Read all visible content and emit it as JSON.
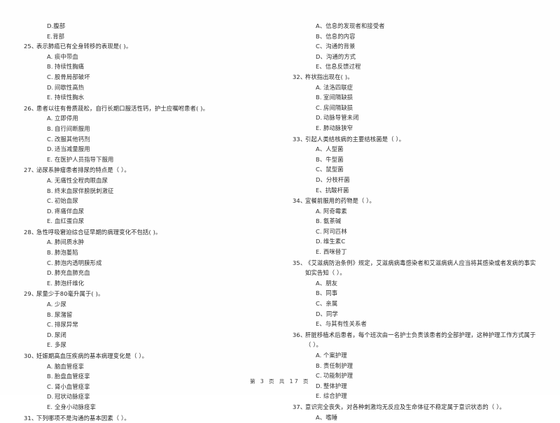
{
  "document": {
    "page_label": "第 3 页 共 17 页",
    "page_number": "3",
    "total_pages": "17"
  },
  "left_column": {
    "leading_options": [
      {
        "label": "D.",
        "text": "腹部"
      },
      {
        "label": "E.",
        "text": "背部"
      }
    ],
    "questions": [
      {
        "number": "25、",
        "stem": "表示肺癌已有全身转移的表现是(        )。",
        "options": [
          {
            "label": "A.",
            "text": "痰中带血"
          },
          {
            "label": "B.",
            "text": "持续性胸痛"
          },
          {
            "label": "C.",
            "text": "股骨局部破坏"
          },
          {
            "label": "D.",
            "text": "间歇性高热"
          },
          {
            "label": "E.",
            "text": "持续性胸水"
          }
        ]
      },
      {
        "number": "26、",
        "stem": "患者以往有骨质疏松，自行长期口服活性钙，护士应嘱咐患者(        )。",
        "options": [
          {
            "label": "A.",
            "text": "立即停用"
          },
          {
            "label": "B.",
            "text": "自行间断服用"
          },
          {
            "label": "C.",
            "text": "改服其他钙剂"
          },
          {
            "label": "D.",
            "text": "适当减量服用"
          },
          {
            "label": "E.",
            "text": "在医护人员指导下服用"
          }
        ]
      },
      {
        "number": "27、",
        "stem": "泌尿系肿瘤患者排尿的特点是（        ）。",
        "options": [
          {
            "label": "A.",
            "text": "无痛性全程肉眼血尿"
          },
          {
            "label": "B.",
            "text": "终末血尿伴膀胱刺激征"
          },
          {
            "label": "C.",
            "text": "初始血尿"
          },
          {
            "label": "D.",
            "text": "疼痛伴血尿"
          },
          {
            "label": "E.",
            "text": "血红蛋白尿"
          }
        ]
      },
      {
        "number": "28、",
        "stem": "急性呼吸窘迫综合征早期的病理变化不包括(        )。",
        "options": [
          {
            "label": "A.",
            "text": "肺间质水肿"
          },
          {
            "label": "B.",
            "text": "肺泡萎陷"
          },
          {
            "label": "C.",
            "text": "肺泡内透明膜形成"
          },
          {
            "label": "D.",
            "text": "肺充血肺充血"
          },
          {
            "label": "E.",
            "text": "肺泡纤维化"
          }
        ]
      },
      {
        "number": "29、",
        "stem": "尿量少于80毫升属于(        )。",
        "options": [
          {
            "label": "A.",
            "text": "少尿"
          },
          {
            "label": "B.",
            "text": "尿潴留"
          },
          {
            "label": "C.",
            "text": "排尿异常"
          },
          {
            "label": "D.",
            "text": "尿闭"
          },
          {
            "label": "E.",
            "text": "多尿"
          }
        ]
      },
      {
        "number": "30、",
        "stem": "妊娠期高血压疾病的基本病理变化是（        ）。",
        "options": [
          {
            "label": "A.",
            "text": "脑血管痉挛"
          },
          {
            "label": "B.",
            "text": "胎盘血管痉挛"
          },
          {
            "label": "C.",
            "text": "肾小血管痉挛"
          },
          {
            "label": "D.",
            "text": "冠状动脉痉挛"
          },
          {
            "label": "E.",
            "text": "全身小动脉痉挛"
          }
        ]
      },
      {
        "number": "31、",
        "stem": "下列哪项不是沟通的基本因素（        ）。",
        "options": []
      }
    ]
  },
  "right_column": {
    "leading_options": [
      {
        "label": "A、",
        "text": "信息的发现者和接受者"
      },
      {
        "label": "B、",
        "text": "信息的内容"
      },
      {
        "label": "C、",
        "text": "沟通的背景"
      },
      {
        "label": "D、",
        "text": "沟通的方式"
      },
      {
        "label": "E、",
        "text": "信息反馈过程"
      }
    ],
    "questions": [
      {
        "number": "32、",
        "stem": "杵状指出现在(        )。",
        "options": [
          {
            "label": "A.",
            "text": "法洛四联症"
          },
          {
            "label": "B.",
            "text": "室间隔缺损"
          },
          {
            "label": "C.",
            "text": "房间隔缺损"
          },
          {
            "label": "D.",
            "text": "动脉导管未闭"
          },
          {
            "label": "E.",
            "text": "肺动脉狭窄"
          }
        ]
      },
      {
        "number": "33、",
        "stem": "引起人类结核病的主要结核菌是（        ）。",
        "options": [
          {
            "label": "A、",
            "text": "人型菌"
          },
          {
            "label": "B、",
            "text": "牛型菌"
          },
          {
            "label": "C、",
            "text": "鼠型菌"
          },
          {
            "label": "D、",
            "text": "分枝杆菌"
          },
          {
            "label": "E、",
            "text": "抗酸杆菌"
          }
        ]
      },
      {
        "number": "34、",
        "stem": "宜餐前服用的药物是（        ）。",
        "options": [
          {
            "label": "A.",
            "text": "阿奇霉素"
          },
          {
            "label": "B.",
            "text": "氨茶碱"
          },
          {
            "label": "C.",
            "text": "阿司匹林"
          },
          {
            "label": "D.",
            "text": "维生素C"
          },
          {
            "label": "E.",
            "text": "西咪替丁"
          }
        ]
      },
      {
        "number": "35、",
        "stem": "《艾滋病防治条例》规定，艾滋病病毒感染者和艾滋病病人应当将其感染或者发病的事实如实告知（        ）。",
        "options": [
          {
            "label": "A、",
            "text": "朋友"
          },
          {
            "label": "B、",
            "text": "同事"
          },
          {
            "label": "C、",
            "text": "亲属"
          },
          {
            "label": "D、",
            "text": "同学"
          },
          {
            "label": "E、",
            "text": "与其有性关系者"
          }
        ]
      },
      {
        "number": "36、",
        "stem": "肝脏移植术后患者，每个班次由一名护士负责该患者的全部护理，这种护理工作方式属于（        ）。",
        "options": [
          {
            "label": "A.",
            "text": "个案护理"
          },
          {
            "label": "B.",
            "text": "责任制护理"
          },
          {
            "label": "C.",
            "text": "功能制护理"
          },
          {
            "label": "D.",
            "text": "整体护理"
          },
          {
            "label": "E.",
            "text": "综合护理"
          }
        ]
      },
      {
        "number": "37、",
        "stem": "意识完全丧失，对各种刺激均无反应及生命体征不稳定属于意识状态的（        ）。",
        "options": [
          {
            "label": "A、",
            "text": "嗜睡"
          }
        ]
      }
    ]
  }
}
